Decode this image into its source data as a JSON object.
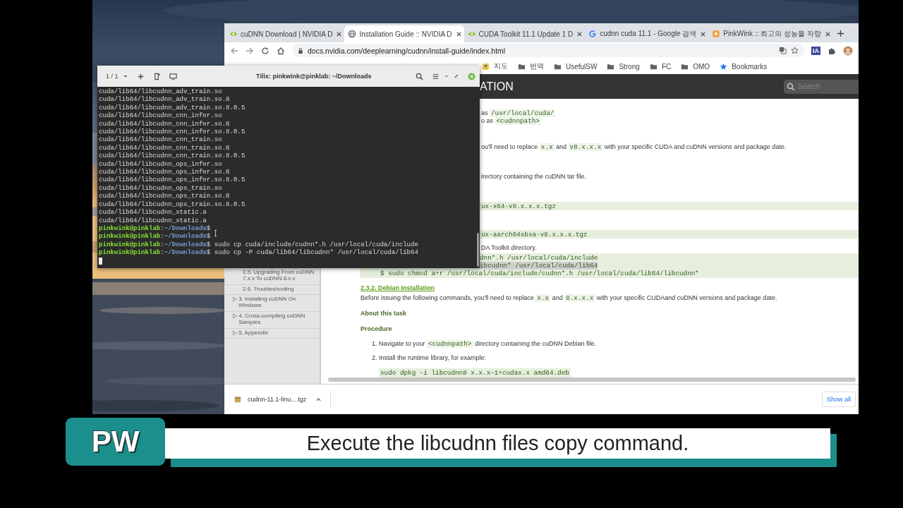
{
  "browser": {
    "tabs": [
      {
        "title": "cuDNN Download | NVIDIA D",
        "selected": false
      },
      {
        "title": "Installation Guide :: NVIDIA D",
        "selected": true
      },
      {
        "title": "CUDA Toolkit 11.1 Update 1 D",
        "selected": false
      },
      {
        "title": "cudnn cuda 11.1 - Google 검색",
        "selected": false
      },
      {
        "title": "PinkWink :: 최고의 성능을 자랑",
        "selected": false
      }
    ],
    "address": "docs.nvidia.com/deeplearning/cudnn/install-guide/index.html",
    "extension_label": "IA",
    "bookmarks": [
      "지도",
      "번역",
      "UsefulSW",
      "Strong",
      "FC",
      "OMO",
      "Bookmarks"
    ],
    "page": {
      "header_title": "ATION",
      "search": {
        "placeholder": "Search"
      },
      "sidebar": {
        "items": [
          {
            "children": [
              {
                "label": "2.5. Upgrading From cuDNN 7.x.x To cuDNN 8.x.x"
              },
              {
                "label": "2.6. Troubleshooting"
              }
            ]
          },
          {
            "toggle": "▷",
            "label": "3. Installing cuDNN On Windows"
          },
          {
            "toggle": "▷",
            "label": "4. Cross-compiling cuDNN Samples"
          },
          {
            "toggle": "▷",
            "label": "5. Appendix"
          }
        ]
      },
      "content": [
        {
          "kind": "cut-text",
          "parts": [
            {
              "kind": "text",
              "text": "as"
            },
            {
              "kind": "code",
              "text": "/usr/local/cuda/"
            }
          ]
        },
        {
          "kind": "cut-text",
          "parts": [
            {
              "kind": "text",
              "text": "o as"
            },
            {
              "kind": "code",
              "text": "<cudnnpath>"
            }
          ]
        },
        {
          "kind": "cut-text",
          "parts": [
            {
              "kind": "text",
              "text": "ou'll need to replace"
            },
            {
              "kind": "code",
              "text": "x.x"
            },
            {
              "kind": "text",
              "text": "and"
            },
            {
              "kind": "code",
              "text": "v8.x.x.x"
            },
            {
              "kind": "text",
              "text": "with your specific CUDA and cuDNN versions and package date."
            }
          ]
        },
        {
          "kind": "cut-text",
          "parts": [
            {
              "kind": "text",
              "text": "irectory containing the cuDNN tar file."
            }
          ]
        },
        {
          "kind": "cut-code",
          "lines": [
            {
              "text": "ux-x64-v8.x.x.x.tgz",
              "selected": false
            }
          ]
        },
        {
          "kind": "cut-code",
          "lines": [
            {
              "text": "ux-aarch64sbsa-v8.x.x.x.tgz",
              "selected": false
            }
          ]
        },
        {
          "kind": "cut-text",
          "parts": [
            {
              "kind": "text",
              "text": "DA Toolkit directory."
            }
          ]
        },
        {
          "kind": "code-block",
          "lines": [
            {
              "text": "dnn*.h /usr/local/cuda/include",
              "cut": true,
              "selected": false
            },
            {
              "text": "ibcudnn* /usr/local/cuda/lib64",
              "cut": true,
              "selected": true
            },
            {
              "text": "$ sudo chmod a+r /usr/local/cuda/include/cudnn*.h /usr/local/cuda/lib64/libcudnn*",
              "cut": false,
              "selected": false
            }
          ]
        },
        {
          "kind": "heading",
          "text": "2.3.2. Debian Installation"
        },
        {
          "kind": "text",
          "parts": [
            {
              "kind": "text",
              "text": "Before issuing the following commands, you'll need to replace"
            },
            {
              "kind": "code",
              "text": "x.x"
            },
            {
              "kind": "text",
              "text": "and"
            },
            {
              "kind": "code",
              "text": "8.x.x.x"
            },
            {
              "kind": "text",
              "text": "with your specific CUDAand cuDNN versions and package date."
            }
          ]
        },
        {
          "kind": "label",
          "text": "About this task"
        },
        {
          "kind": "label",
          "text": "Procedure"
        },
        {
          "kind": "step",
          "number": "1.",
          "parts": [
            {
              "kind": "text",
              "text": "Navigate to your"
            },
            {
              "kind": "code",
              "text": "<cudnnpath>"
            },
            {
              "kind": "text",
              "text": "directory containing the cuDNN Debian file."
            }
          ]
        },
        {
          "kind": "step",
          "number": "2.",
          "parts": [
            {
              "kind": "text",
              "text": "Install the runtime library, for example:"
            }
          ]
        },
        {
          "kind": "code-line",
          "text": "sudo dpkg -i libcudnn8 x.x.x-1+cudax.x amd64.deb"
        }
      ]
    },
    "download": {
      "file": "cudnn-11.1-linu....tgz",
      "show_all": "Show all"
    }
  },
  "terminal": {
    "session": "1 / 1",
    "title": "Tilix: pinkwink@pinklab: ~/Downloads",
    "lines": [
      {
        "kind": "output",
        "text": "cuda/lib64/libcudnn_adv_train.so"
      },
      {
        "kind": "output",
        "text": "cuda/lib64/libcudnn_adv_train.so.8"
      },
      {
        "kind": "output",
        "text": "cuda/lib64/libcudnn_adv_train.so.8.0.5"
      },
      {
        "kind": "output",
        "text": "cuda/lib64/libcudnn_cnn_infer.so"
      },
      {
        "kind": "output",
        "text": "cuda/lib64/libcudnn_cnn_infer.so.8"
      },
      {
        "kind": "output",
        "text": "cuda/lib64/libcudnn_cnn_infer.so.8.0.5"
      },
      {
        "kind": "output",
        "text": "cuda/lib64/libcudnn_cnn_train.so"
      },
      {
        "kind": "output",
        "text": "cuda/lib64/libcudnn_cnn_train.so.8"
      },
      {
        "kind": "output",
        "text": "cuda/lib64/libcudnn_cnn_train.so.8.0.5"
      },
      {
        "kind": "output",
        "text": "cuda/lib64/libcudnn_ops_infer.so"
      },
      {
        "kind": "output",
        "text": "cuda/lib64/libcudnn_ops_infer.so.8"
      },
      {
        "kind": "output",
        "text": "cuda/lib64/libcudnn_ops_infer.so.8.0.5"
      },
      {
        "kind": "output",
        "text": "cuda/lib64/libcudnn_ops_train.so"
      },
      {
        "kind": "output",
        "text": "cuda/lib64/libcudnn_ops_train.so.8"
      },
      {
        "kind": "output",
        "text": "cuda/lib64/libcudnn_ops_train.so.8.0.5"
      },
      {
        "kind": "output",
        "text": "cuda/lib64/libcudnn_static.a"
      },
      {
        "kind": "output",
        "text": "cuda/lib64/libcudnn_static.a"
      },
      {
        "kind": "prompt",
        "user": "pinkwink@pinklab",
        "sep": ":",
        "path": "~/Downloads",
        "symbol": "$"
      },
      {
        "kind": "prompt",
        "user": "pinkwink@pinklab",
        "sep": ":",
        "path": "~/Downloads",
        "symbol": "$"
      },
      {
        "kind": "prompt",
        "user": "pinkwink@pinklab",
        "sep": ":",
        "path": "~/Downloads",
        "symbol": "$",
        "command": "sudo cp cuda/include/cudnn*.h /usr/local/cuda/include"
      },
      {
        "kind": "prompt",
        "user": "pinkwink@pinklab",
        "sep": ":",
        "path": "~/Downloads",
        "symbol": "$",
        "command": "sudo cp -P cuda/lib64/libcudnn* /usr/local/cuda/lib64"
      }
    ]
  },
  "caption": {
    "badge": "PW",
    "text": "Execute the libcudnn files copy command."
  }
}
